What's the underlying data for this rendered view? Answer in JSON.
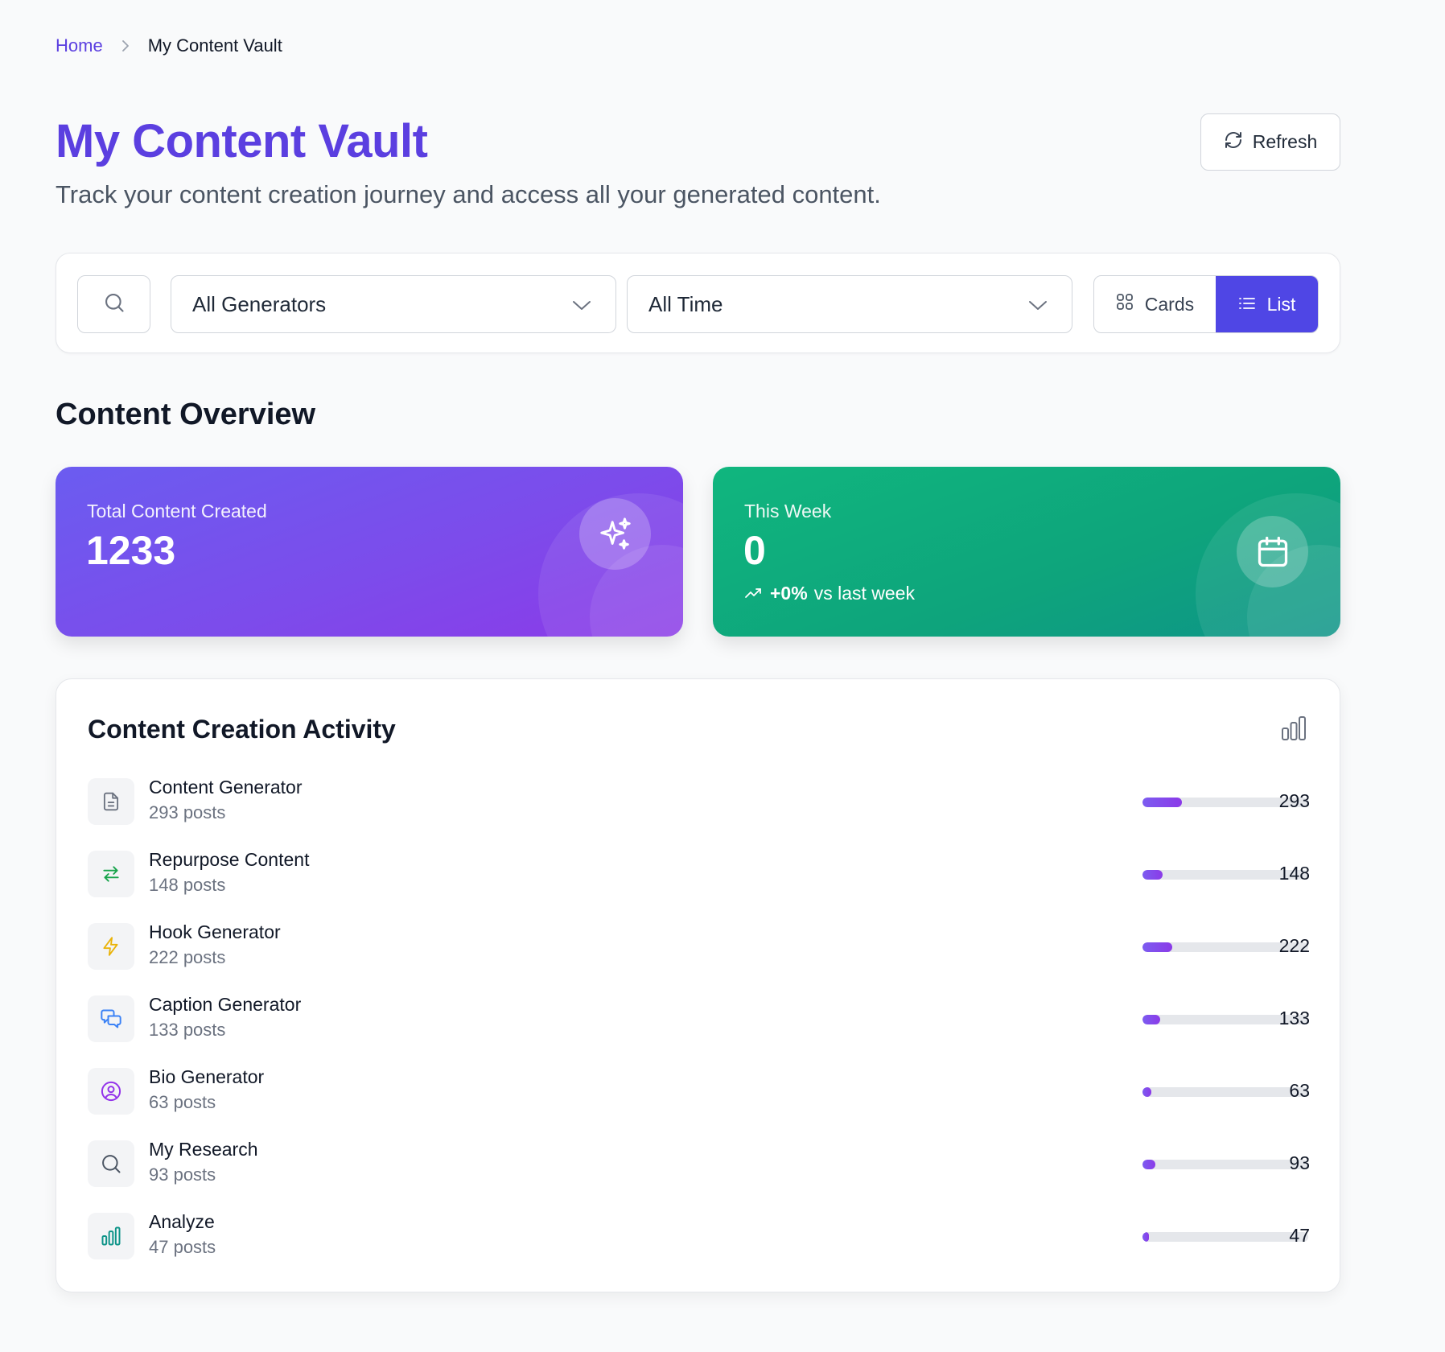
{
  "breadcrumb": {
    "home": "Home",
    "current": "My Content Vault"
  },
  "header": {
    "title": "My Content Vault",
    "subtitle": "Track your content creation journey and access all your generated content.",
    "refresh_label": "Refresh"
  },
  "filters": {
    "search_icon": "search-icon",
    "generator": {
      "selected": "All Generators"
    },
    "time": {
      "selected": "All Time"
    },
    "view": {
      "cards_label": "Cards",
      "list_label": "List",
      "active": "List"
    }
  },
  "overview": {
    "title": "Content Overview",
    "total": {
      "label": "Total Content Created",
      "value": "1233",
      "icon": "sparkles-icon"
    },
    "week": {
      "label": "This Week",
      "value": "0",
      "trend_value": "+0%",
      "trend_suffix": "vs last week",
      "icon": "calendar-icon"
    }
  },
  "activity": {
    "title": "Content Creation Activity",
    "icon": "bar-chart-icon",
    "max_count": 1233,
    "rows": [
      {
        "name": "Content Generator",
        "sub": "293 posts",
        "count": "293",
        "value": 293,
        "icon": "document-icon",
        "icon_color": "#6b7280"
      },
      {
        "name": "Repurpose Content",
        "sub": "148 posts",
        "count": "148",
        "value": 148,
        "icon": "repeat-arrows-icon",
        "icon_color": "#16a34a"
      },
      {
        "name": "Hook Generator",
        "sub": "222 posts",
        "count": "222",
        "value": 222,
        "icon": "lightning-icon",
        "icon_color": "#eab308"
      },
      {
        "name": "Caption Generator",
        "sub": "133 posts",
        "count": "133",
        "value": 133,
        "icon": "chat-bubbles-icon",
        "icon_color": "#3b82f6"
      },
      {
        "name": "Bio Generator",
        "sub": "63 posts",
        "count": "63",
        "value": 63,
        "icon": "user-circle-icon",
        "icon_color": "#9333ea"
      },
      {
        "name": "My Research",
        "sub": "93 posts",
        "count": "93",
        "value": 93,
        "icon": "search-icon",
        "icon_color": "#4b5563"
      },
      {
        "name": "Analyze",
        "sub": "47 posts",
        "count": "47",
        "value": 47,
        "icon": "bar-chart-icon",
        "icon_color": "#0d9488"
      }
    ]
  },
  "colors": {
    "accent": "#5b3fe0",
    "primary_button": "#4f46e5",
    "purple_card": "#7c4ceb",
    "green_card": "#10a37f",
    "bar_fill": "#7c5cf0",
    "bar_track": "#e5e7eb"
  }
}
